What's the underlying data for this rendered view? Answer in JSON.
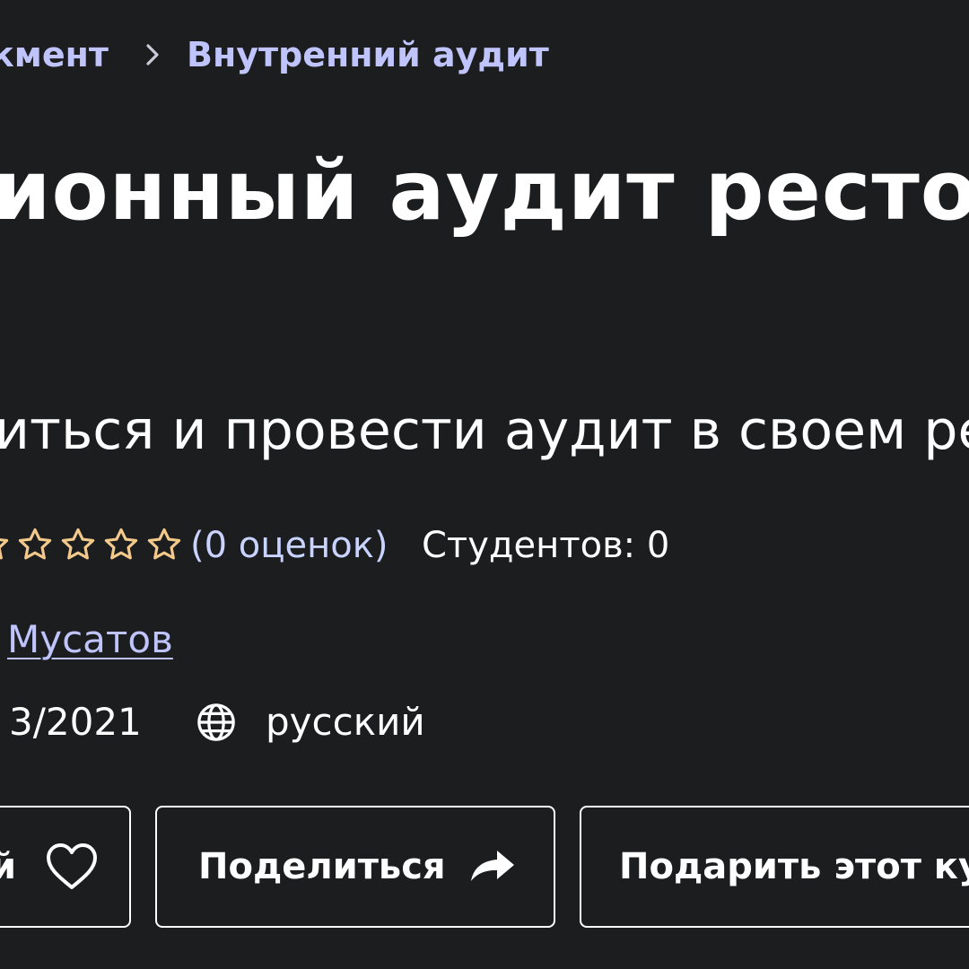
{
  "breadcrumb": {
    "items": [
      "кмент",
      "Внутренний аудит"
    ]
  },
  "course": {
    "title": "ионный аудит рестор",
    "subtitle": "иться и провести аудит в своем ресто",
    "rating": {
      "value": 0,
      "max": 5,
      "count_label": "(0 оценок)"
    },
    "students_label": "Студентов: 0",
    "author": "Мусатов",
    "updated": "3/2021",
    "language": "русский"
  },
  "actions": {
    "wishlist_label": "й",
    "share_label": "Поделиться",
    "gift_label": "Подарить этот ку"
  },
  "icons": {
    "breadcrumb_separator": "chevron-right-icon",
    "rating": "star-outline-icon",
    "language": "globe-icon",
    "wishlist": "heart-outline-icon",
    "share": "share-arrow-icon"
  },
  "colors": {
    "background": "#1c1d1f",
    "link": "#c0c4fc",
    "rating_star": "#f3ca8c",
    "text": "#ffffff"
  }
}
